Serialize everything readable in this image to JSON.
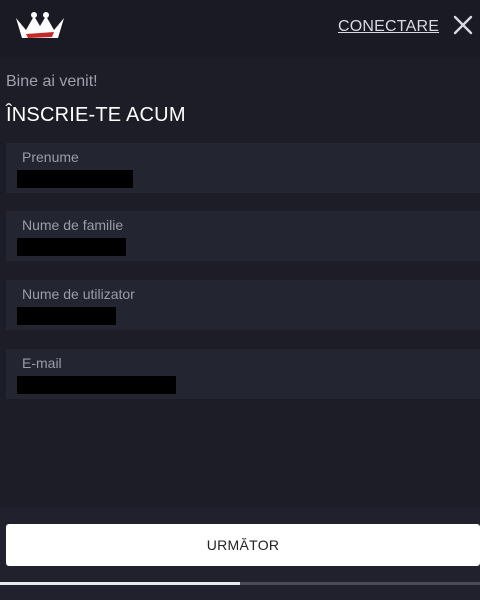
{
  "header": {
    "logo_icon": "crown-logo-icon",
    "login_label": "CONECTARE",
    "close_icon": "close-icon"
  },
  "form": {
    "welcome": "Bine ai venit!",
    "title": "ÎNSCRIE-TE ACUM",
    "fields": [
      {
        "label": "Prenume",
        "value": ""
      },
      {
        "label": "Nume de familie",
        "value": ""
      },
      {
        "label": "Nume de utilizator",
        "value": ""
      },
      {
        "label": "E-mail",
        "value": ""
      }
    ]
  },
  "footer": {
    "next_label": "URMĂTOR",
    "progress": 0.5
  },
  "colors": {
    "background": "#1c1d27",
    "field_background": "#232531",
    "button": "#ffffff",
    "logo_red": "#c62828"
  }
}
